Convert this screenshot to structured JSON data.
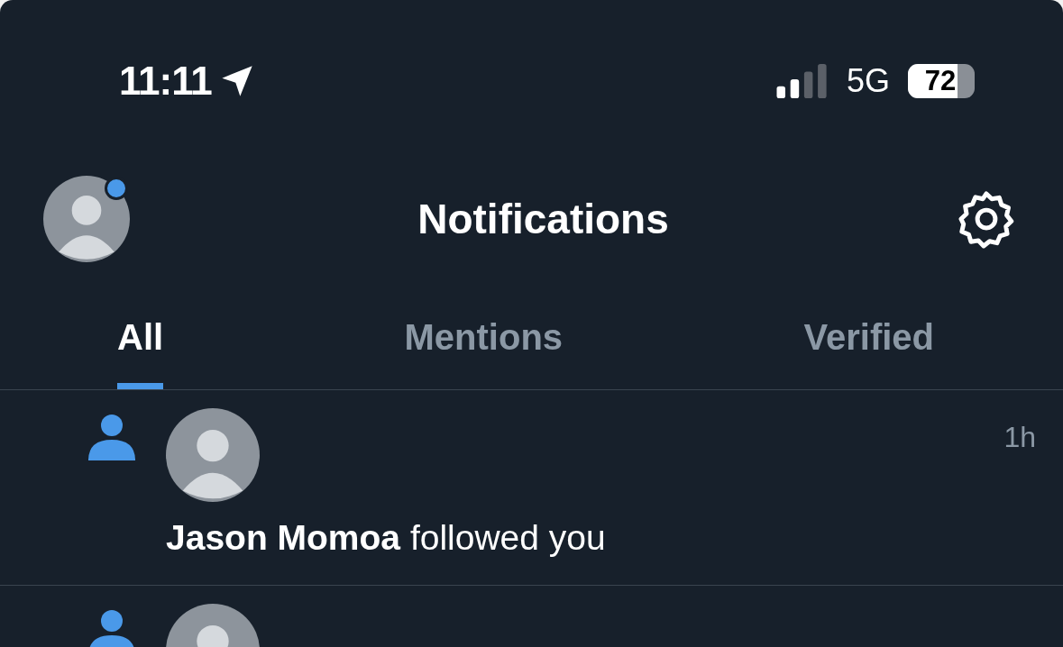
{
  "status_bar": {
    "time": "11:11",
    "network": "5G",
    "battery": "72"
  },
  "header": {
    "title": "Notifications",
    "has_unread_badge": true
  },
  "tabs": [
    {
      "label": "All",
      "selected": true
    },
    {
      "label": "Mentions",
      "selected": false
    },
    {
      "label": "Verified",
      "selected": false
    }
  ],
  "notifications": [
    {
      "kind": "follow",
      "text": "**Jason Momoa** followed you",
      "time": "1h"
    },
    {
      "kind": "follow"
    }
  ]
}
